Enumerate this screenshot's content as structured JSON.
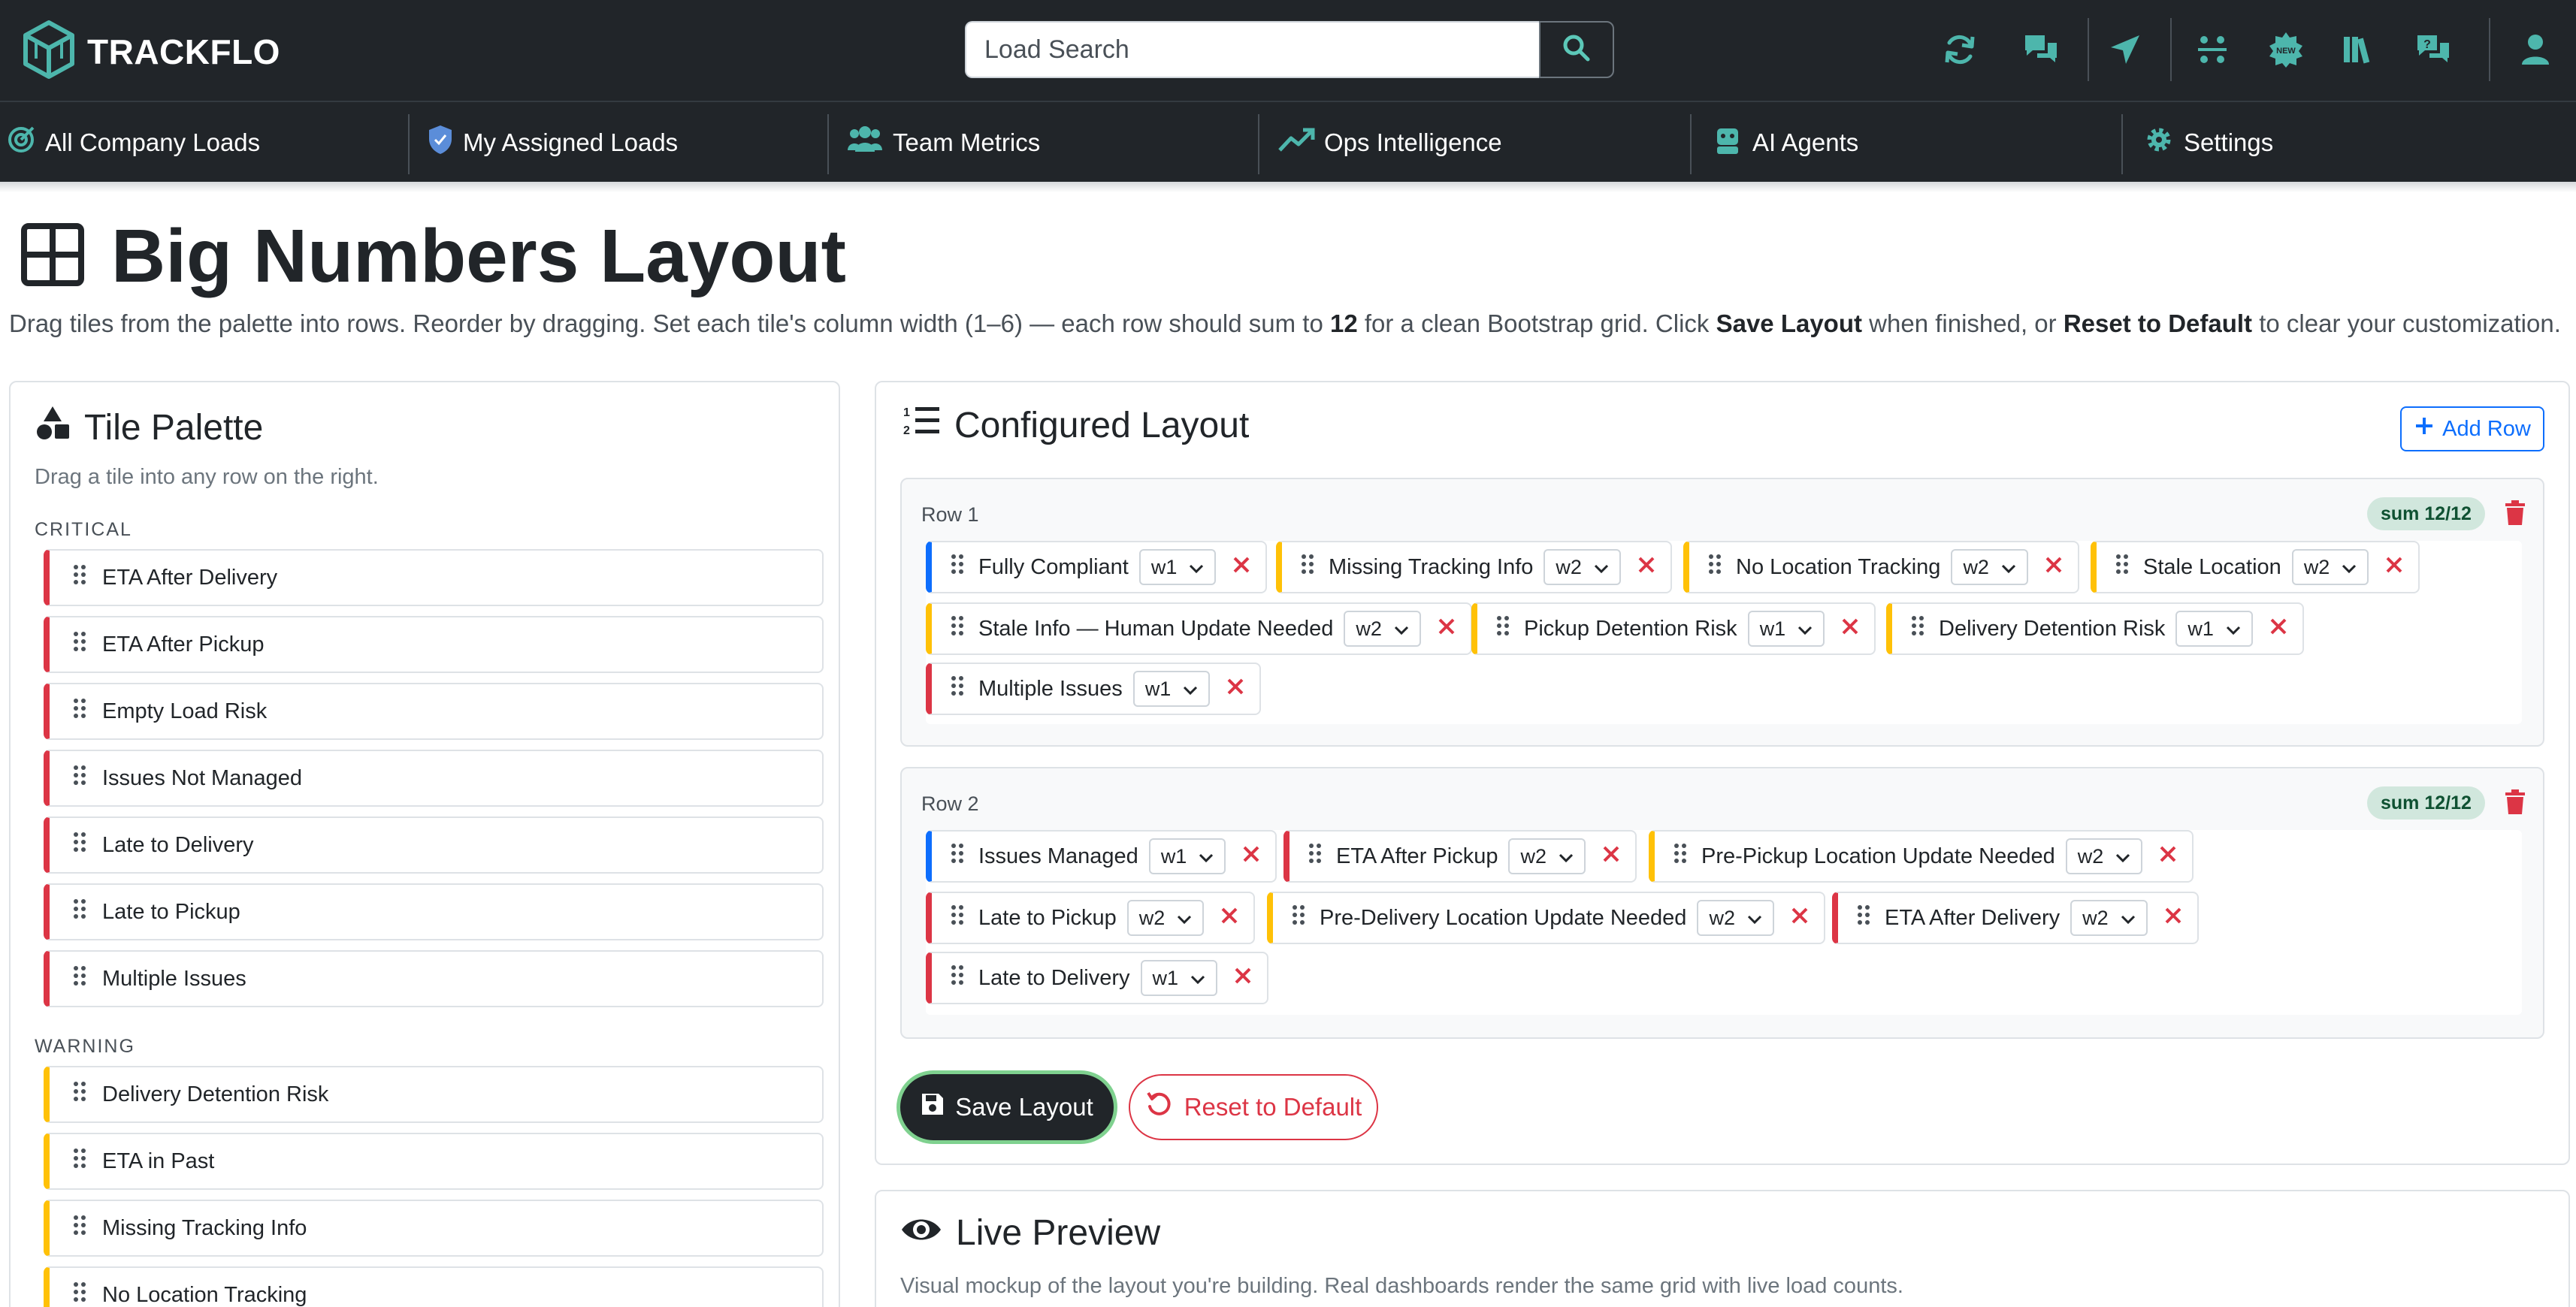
{
  "app": {
    "brand": "TRACKFLO"
  },
  "search": {
    "placeholder": "Load Search"
  },
  "top_icons": [
    "refresh-icon",
    "chat-icon",
    "send-icon",
    "split-icon",
    "new-badge-icon",
    "books-icon",
    "question-chat-icon",
    "user-icon"
  ],
  "nav": [
    {
      "label": "All Company Loads",
      "icon": "target-check-icon"
    },
    {
      "label": "My Assigned Loads",
      "icon": "shield-check-icon"
    },
    {
      "label": "Team Metrics",
      "icon": "people-icon"
    },
    {
      "label": "Ops Intelligence",
      "icon": "trend-up-icon"
    },
    {
      "label": "AI Agents",
      "icon": "robot-icon"
    },
    {
      "label": "Settings",
      "icon": "gear-icon"
    }
  ],
  "page": {
    "title": "Big Numbers Layout",
    "desc_1": "Drag tiles from the palette into rows. Reorder by dragging. Set each tile's column width (1–6) — each row should sum to ",
    "desc_2": "12",
    "desc_3": " for a clean Bootstrap grid. Click ",
    "desc_4": "Save Layout",
    "desc_5": " when finished, or ",
    "desc_6": "Reset to Default",
    "desc_7": " to clear your customization."
  },
  "palette": {
    "title": "Tile Palette",
    "hint": "Drag a tile into any row on the right.",
    "critical_label": "CRITICAL",
    "critical": [
      "ETA After Delivery",
      "ETA After Pickup",
      "Empty Load Risk",
      "Issues Not Managed",
      "Late to Delivery",
      "Late to Pickup",
      "Multiple Issues"
    ],
    "warning_label": "WARNING",
    "warning": [
      "Delivery Detention Risk",
      "ETA in Past",
      "Missing Tracking Info",
      "No Location Tracking"
    ]
  },
  "layout": {
    "title": "Configured Layout",
    "add_row": "Add Row",
    "rows": [
      {
        "label": "Row 1",
        "sum": "sum 12/12",
        "tiles": [
          {
            "name": "Fully Compliant",
            "width": "w1",
            "level": "info"
          },
          {
            "name": "Missing Tracking Info",
            "width": "w2",
            "level": "warning"
          },
          {
            "name": "No Location Tracking",
            "width": "w2",
            "level": "warning"
          },
          {
            "name": "Stale Location",
            "width": "w2",
            "level": "warning"
          },
          {
            "name": "Stale Info — Human Update Needed",
            "width": "w2",
            "level": "warning"
          },
          {
            "name": "Pickup Detention Risk",
            "width": "w1",
            "level": "warning"
          },
          {
            "name": "Delivery Detention Risk",
            "width": "w1",
            "level": "warning"
          },
          {
            "name": "Multiple Issues",
            "width": "w1",
            "level": "critical"
          }
        ]
      },
      {
        "label": "Row 2",
        "sum": "sum 12/12",
        "tiles": [
          {
            "name": "Issues Managed",
            "width": "w1",
            "level": "info"
          },
          {
            "name": "ETA After Pickup",
            "width": "w2",
            "level": "critical"
          },
          {
            "name": "Pre-Pickup Location Update Needed",
            "width": "w2",
            "level": "warning"
          },
          {
            "name": "Late to Pickup",
            "width": "w2",
            "level": "critical"
          },
          {
            "name": "Pre-Delivery Location Update Needed",
            "width": "w2",
            "level": "warning"
          },
          {
            "name": "ETA After Delivery",
            "width": "w2",
            "level": "critical"
          },
          {
            "name": "Late to Delivery",
            "width": "w1",
            "level": "critical"
          }
        ]
      }
    ],
    "save": "Save Layout",
    "reset": "Reset to Default"
  },
  "preview": {
    "title": "Live Preview",
    "desc": "Visual mockup of the layout you're building. Real dashboards render the same grid with live load counts."
  },
  "colors": {
    "info": "#0d6efd",
    "critical": "#dc3545",
    "warning": "#ffc107",
    "brand": "#4db6ac",
    "success_bg": "#d1e7dd"
  }
}
